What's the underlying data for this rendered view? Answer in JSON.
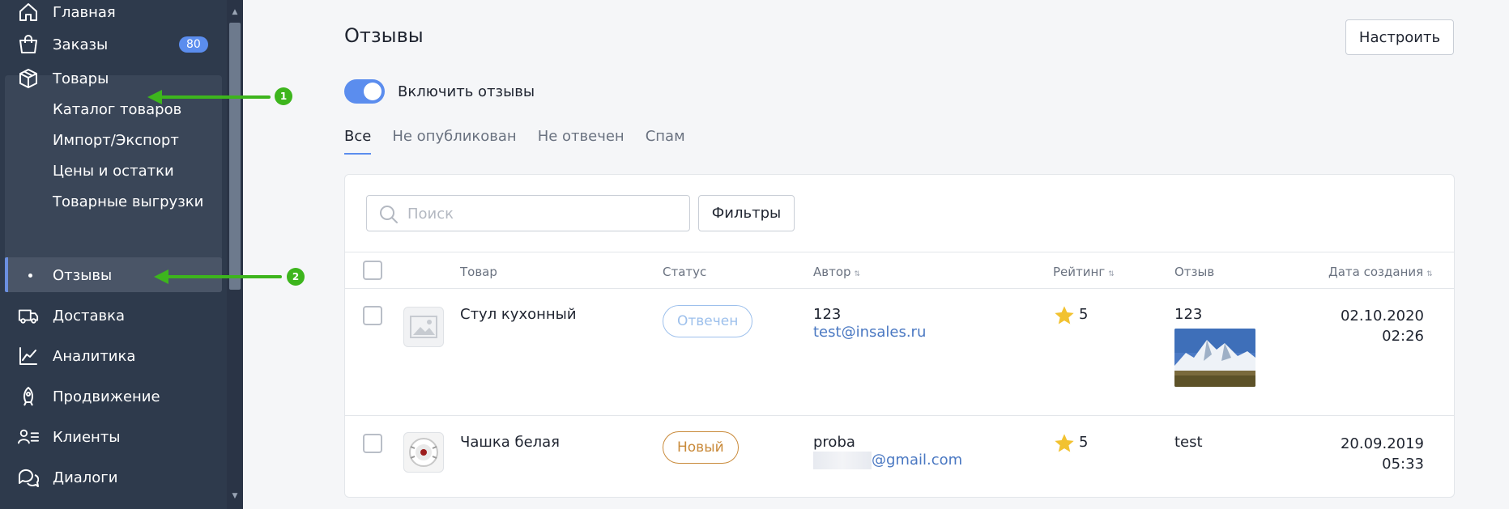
{
  "sidebar": {
    "items": [
      {
        "label": "Главная",
        "icon": "home-icon"
      },
      {
        "label": "Заказы",
        "icon": "bag-icon",
        "badge": "80"
      },
      {
        "label": "Товары",
        "icon": "box-icon"
      },
      {
        "label": "Доставка",
        "icon": "truck-icon"
      },
      {
        "label": "Аналитика",
        "icon": "chart-icon"
      },
      {
        "label": "Продвижение",
        "icon": "rocket-icon"
      },
      {
        "label": "Клиенты",
        "icon": "clients-icon"
      },
      {
        "label": "Диалоги",
        "icon": "chat-icon"
      }
    ],
    "subitems": [
      {
        "label": "Каталог товаров"
      },
      {
        "label": "Импорт/Экспорт"
      },
      {
        "label": "Цены и остатки"
      },
      {
        "label": "Товарные выгрузки"
      },
      {
        "label": "Отзывы"
      }
    ]
  },
  "annotations": {
    "one": "1",
    "two": "2",
    "color": "#3db51d"
  },
  "page": {
    "title": "Отзывы",
    "settings_button": "Настроить",
    "toggle_label": "Включить отзывы",
    "tabs": [
      "Все",
      "Не опубликован",
      "Не отвечен",
      "Спам"
    ]
  },
  "search": {
    "placeholder": "Поиск"
  },
  "filters_button": "Фильтры",
  "table": {
    "headers": {
      "product": "Товар",
      "status": "Статус",
      "author": "Автор",
      "rating": "Рейтинг",
      "review": "Отзыв",
      "created": "Дата создания"
    },
    "rows": [
      {
        "product": "Стул кухонный",
        "status": "Отвечен",
        "author_name": "123",
        "author_email": "test@insales.ru",
        "rating": "5",
        "review": "123",
        "date": "02.10.2020",
        "time": "02:26"
      },
      {
        "product": "Чашка белая",
        "status": "Новый",
        "author_name": "proba",
        "author_email": "@gmail.com",
        "rating": "5",
        "review": "test",
        "date": "20.09.2019",
        "time": "05:33"
      }
    ]
  },
  "colors": {
    "sidebar_bg": "#2e3a4c",
    "accent": "#5b8dee",
    "status_answered": "#9dc0ec",
    "status_new": "#c98a3a",
    "star": "#f2c230"
  }
}
